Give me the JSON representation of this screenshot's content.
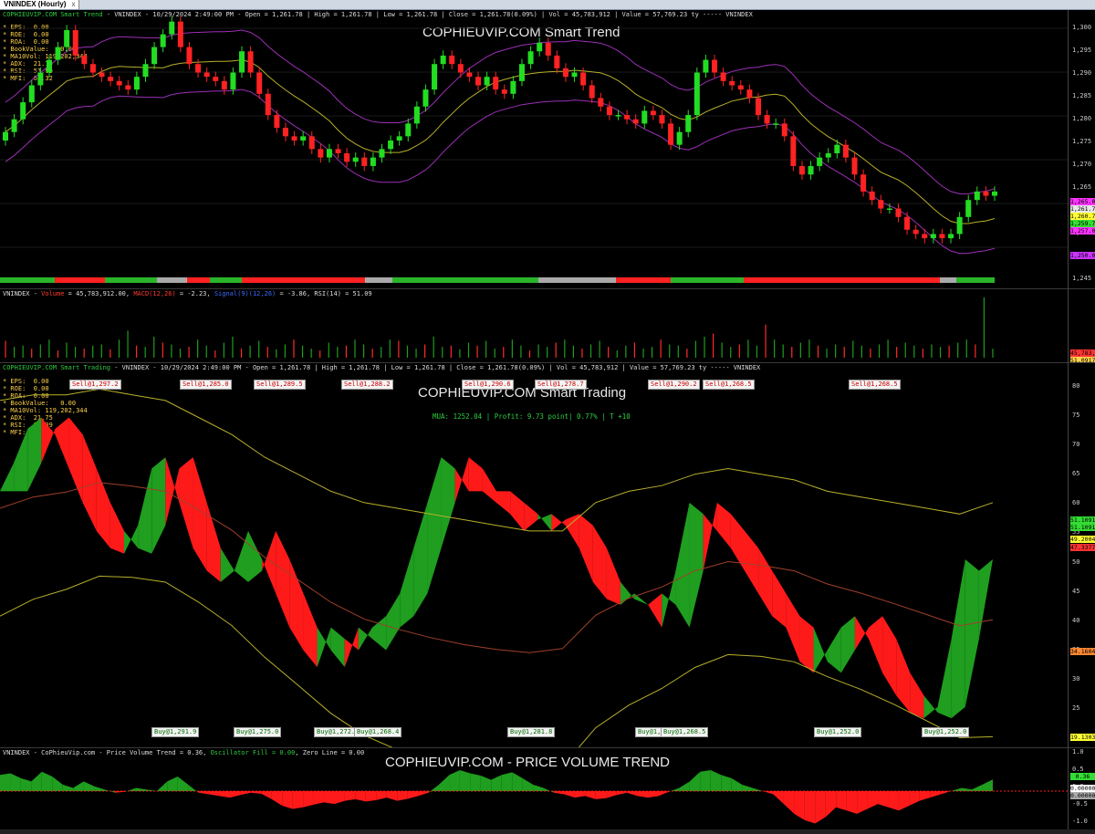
{
  "tab": {
    "label": "VNINDEX (Hourly)",
    "close": "x"
  },
  "pane1": {
    "header": [
      {
        "t": "COPHIEUVIP.COM Smart Trend",
        "c": "g"
      },
      {
        "t": " - VNINDEX - 10/29/2024 2:49:00 PM - Open = 1,261.78 | High = 1,261.78 | Low = 1,261.78 | Close = 1,261.78(0.09%) | Vol = 45,783,912 | Value = 57,769.23 ty ----- VNINDEX",
        "c": "w"
      }
    ],
    "title": "COPHIEUVIP.COM Smart Trend",
    "fund": [
      "* EPS:  0.00",
      "* ROE:  0.00",
      "* ROA:  0.00",
      "* BookValue:   0.00",
      "* MA10Vol: 119,202,344",
      "* ADX:  21.75",
      "* RSI:  51.09",
      "* MFI:  61.32"
    ],
    "ticks": [
      "1,300",
      "1,295",
      "1,290",
      "1,285",
      "1,280",
      "1,275",
      "1,270",
      "1,265",
      "1,260",
      "1,255",
      "1,250",
      "1,245"
    ],
    "tags": [
      {
        "v": "1,265.00",
        "bg": "#ff33ff"
      },
      {
        "v": "1,261.78",
        "bg": "#e6e6e6"
      },
      {
        "v": "1,260.74",
        "bg": "#ffff33"
      },
      {
        "v": "1,259.74",
        "bg": "#33dd33"
      },
      {
        "v": "1,257.00",
        "bg": "#ff33ff"
      },
      {
        "v": "1,250.00",
        "bg": "#cc33ff"
      }
    ]
  },
  "pane2": {
    "header": [
      {
        "t": "VNINDEX - ",
        "c": "w"
      },
      {
        "t": "Volume",
        "c": "r"
      },
      {
        "t": " = 45,783,912.00, ",
        "c": "w"
      },
      {
        "t": "MACD(12,26)",
        "c": "r"
      },
      {
        "t": " = -2.23, ",
        "c": "w"
      },
      {
        "t": "Signal(9)(12,26)",
        "c": "b"
      },
      {
        "t": " = -3.86, RSI(14) = 51.09",
        "c": "w"
      }
    ],
    "tags": [
      {
        "v": "45,783,912",
        "bg": "#ff3333"
      },
      {
        "v": "51.0917",
        "bg": "#ffd24a"
      }
    ]
  },
  "pane3": {
    "header": [
      {
        "t": "COPHIEUVIP.COM Smart Trading",
        "c": "g"
      },
      {
        "t": " - VNINDEX - 10/29/2024 2:49:00 PM - Open = 1,261.78 | High = 1,261.78 | Low = 1,261.78 | Close = 1,261.78(0.09%) | Vol = 45,783,912 | Value = 57,769.23 ty ----- VNINDEX",
        "c": "w"
      }
    ],
    "title": "COPHIEUVIP.COM Smart Trading",
    "status": "MUA: 1252.04 | Profit: 9.73 point| 0.77% | T +10",
    "fund": [
      "* EPS:  0.00",
      "* ROE:  0.00",
      "* ROA:  0.00",
      "* BookValue:   0.00",
      "* MA10Vol: 119,202,344",
      "* ADX:  21.75",
      "* RSI:  51.09",
      "* MFI:  61.32"
    ],
    "ticks": [
      "80",
      "75",
      "70",
      "65",
      "60",
      "55",
      "50",
      "45",
      "40",
      "35",
      "30",
      "25",
      "20"
    ],
    "tags": [
      {
        "v": "51.1091",
        "bg": "#33dd33"
      },
      {
        "v": "51.1091",
        "bg": "#33dd33"
      },
      {
        "v": "49.2004",
        "bg": "#ffff33"
      },
      {
        "v": "47.3377",
        "bg": "#ff3333"
      },
      {
        "v": "34.1604",
        "bg": "#ff8833"
      },
      {
        "v": "19.1303",
        "bg": "#ffff33"
      }
    ],
    "sells": [
      "Sell@1,297.2",
      "Sell@1,285.0",
      "Sell@1,289.5",
      "Sell@1,288.2",
      "Sell@1,290.6",
      "Sell@1,278.7",
      "Sell@1,290.2",
      "Sell@1,268.5",
      "Sell@1,268.5"
    ],
    "buys": [
      "Buy@1,291.9",
      "Buy@1,275.0",
      "Buy@1,272.3",
      "Buy@1,268.4",
      "Buy@1,281.8",
      "Buy@1,2",
      "Buy@1,268.5",
      "Buy@1,252.0",
      "Buy@1,252.0"
    ]
  },
  "pane4": {
    "header": [
      {
        "t": "VNINDEX - CoPhieuVip.com - Price Volume Trend = 0.36, ",
        "c": "w"
      },
      {
        "t": "Oscillator Fill = 0.00",
        "c": "g"
      },
      {
        "t": ", Zero Line = 0.00",
        "c": "w"
      }
    ],
    "title": "COPHIEUVIP.COM - PRICE VOLUME TREND",
    "ticks": [
      "1.0",
      "0.5",
      "0.0",
      "-0.5",
      "-1.0"
    ],
    "tags": [
      {
        "v": "0.36",
        "bg": "#33dd33"
      },
      {
        "v": "0.00000",
        "bg": "#ffffff"
      },
      {
        "v": "0.00000",
        "bg": "#aaaaaa"
      }
    ]
  },
  "chart_data": [
    {
      "type": "candlestick",
      "title": "COPHIEUVIP.COM Smart Trend",
      "ylim": [
        1242,
        1303
      ],
      "close": [
        1276,
        1279,
        1283,
        1287,
        1290,
        1293,
        1296,
        1300,
        1294,
        1292,
        1290,
        1289,
        1288,
        1287,
        1286,
        1289,
        1292,
        1296,
        1299,
        1302,
        1296,
        1292,
        1290,
        1289,
        1288,
        1286,
        1290,
        1295,
        1290,
        1285,
        1280,
        1277,
        1275,
        1274,
        1275,
        1272,
        1270,
        1272,
        1271,
        1269,
        1270,
        1268,
        1270,
        1272,
        1274,
        1275,
        1278,
        1282,
        1286,
        1292,
        1294,
        1292,
        1290,
        1289,
        1287,
        1289,
        1286,
        1285,
        1288,
        1292,
        1295,
        1297,
        1294,
        1291,
        1289,
        1290,
        1287,
        1284,
        1282,
        1280,
        1280,
        1279,
        1278,
        1281,
        1280,
        1278,
        1273,
        1276,
        1280,
        1290,
        1293,
        1290,
        1288,
        1287,
        1286,
        1284,
        1280,
        1278,
        1278,
        1275,
        1268,
        1266,
        1268,
        1270,
        1271,
        1273,
        1270,
        1266,
        1262,
        1260,
        1258,
        1258,
        1256,
        1253,
        1252,
        1251,
        1252,
        1251,
        1252,
        1256,
        1260,
        1262,
        1261,
        1262
      ]
    },
    {
      "type": "bar",
      "title": "Volume",
      "values_relative": [
        0.28,
        0.18,
        0.2,
        0.15,
        0.22,
        0.3,
        0.12,
        0.25,
        0.18,
        0.15,
        0.2,
        0.22,
        0.14,
        0.3,
        0.45,
        0.2,
        0.18,
        0.35,
        0.25,
        0.22,
        0.15,
        0.18,
        0.3,
        0.2,
        0.12,
        0.25,
        0.35,
        0.15,
        0.2,
        0.28,
        0.18,
        0.14,
        0.22,
        0.3,
        0.2,
        0.15,
        0.12,
        0.25,
        0.18,
        0.2,
        0.3,
        0.22,
        0.15,
        0.18,
        0.3,
        0.28,
        0.2,
        0.15,
        0.22,
        0.35,
        0.18,
        0.2,
        0.14,
        0.25,
        0.2,
        0.28,
        0.15,
        0.18,
        0.3,
        0.2,
        0.12,
        0.22,
        0.18,
        0.25,
        0.3,
        0.2,
        0.15,
        0.22,
        0.28,
        0.18,
        0.12,
        0.2,
        0.25,
        0.15,
        0.18,
        0.3,
        0.22,
        0.2,
        0.15,
        0.28,
        0.35,
        0.4,
        0.25,
        0.18,
        0.22,
        0.3,
        0.2,
        0.55,
        0.3,
        0.22,
        0.18,
        0.25,
        0.3,
        0.2,
        0.15,
        0.22,
        0.18,
        0.28,
        0.2,
        0.15,
        0.22,
        0.3,
        0.18,
        0.25,
        0.2,
        0.15,
        0.22,
        0.18,
        0.2,
        0.25,
        0.3,
        0.22,
        1.0,
        0.15
      ]
    },
    {
      "type": "area",
      "title": "COPHIEUVIP.COM Smart Trading",
      "ylim": [
        18,
        82
      ],
      "oscillator": [
        62,
        67,
        73,
        75,
        72,
        66,
        60,
        55,
        52,
        51,
        56,
        66,
        68,
        60,
        52,
        48,
        46,
        48,
        55,
        50,
        44,
        38,
        34,
        31,
        38,
        36,
        34,
        38,
        40,
        44,
        52,
        60,
        68,
        66,
        62,
        62,
        60,
        58,
        55,
        57,
        58,
        56,
        52,
        46,
        43,
        42,
        44,
        42,
        38,
        48,
        60,
        58,
        55,
        52,
        48,
        44,
        40,
        38,
        32,
        30,
        34,
        38,
        40,
        36,
        30,
        26,
        23,
        22,
        24,
        36,
        50,
        48,
        50
      ],
      "upper_band": [
        78,
        79,
        79,
        80,
        79,
        78,
        75,
        72,
        68,
        65,
        62,
        60,
        59,
        58,
        57,
        56,
        55,
        55,
        60,
        62,
        63,
        65,
        66,
        65,
        64,
        62,
        61,
        60,
        59,
        58,
        60
      ]
    },
    {
      "type": "area",
      "title": "COPHIEUVIP.COM - PRICE VOLUME TREND",
      "ylim": [
        -1.1,
        1.1
      ],
      "values": [
        0.5,
        0.55,
        0.4,
        0.3,
        0.6,
        0.45,
        0.2,
        0.1,
        0.3,
        0.15,
        0.05,
        -0.05,
        -0.02,
        0.1,
        0.05,
        0.0,
        0.3,
        0.45,
        0.2,
        -0.05,
        -0.1,
        -0.15,
        -0.2,
        -0.12,
        -0.05,
        -0.08,
        -0.25,
        -0.45,
        -0.55,
        -0.5,
        -0.42,
        -0.35,
        -0.4,
        -0.3,
        -0.25,
        -0.32,
        -0.28,
        -0.2,
        -0.3,
        -0.24,
        -0.15,
        -0.05,
        0.2,
        0.5,
        0.65,
        0.55,
        0.48,
        0.35,
        0.5,
        0.58,
        0.4,
        0.2,
        0.1,
        -0.05,
        -0.1,
        -0.2,
        -0.15,
        -0.25,
        -0.22,
        -0.12,
        -0.05,
        -0.15,
        -0.2,
        -0.15,
        -0.02,
        0.1,
        0.3,
        0.6,
        0.65,
        0.5,
        0.4,
        0.2,
        0.1,
        0.0,
        -0.1,
        -0.4,
        -0.7,
        -0.9,
        -1.0,
        -0.8,
        -0.5,
        -0.6,
        -0.7,
        -0.55,
        -0.4,
        -0.5,
        -0.6,
        -0.45,
        -0.3,
        -0.2,
        -0.1,
        0.0,
        0.1,
        0.05,
        0.2,
        0.36
      ]
    }
  ]
}
